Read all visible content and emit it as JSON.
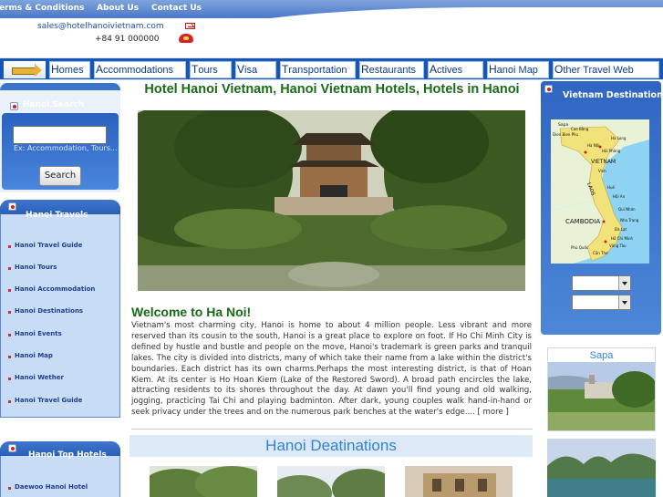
{
  "header": {
    "links": [
      "Terms & Conditions",
      "About Us",
      "Contact Us"
    ],
    "email": "sales@hotelhanoivietnam.com",
    "phone": "+84 91 000000"
  },
  "nav": {
    "items": [
      {
        "first": "H",
        "rest": "omes"
      },
      {
        "first": "A",
        "rest": "ccommodations"
      },
      {
        "first": "T",
        "rest": "ours"
      },
      {
        "first": "V",
        "rest": "isa"
      },
      {
        "first": "T",
        "rest": "ransportation"
      },
      {
        "first": "R",
        "rest": "estaurants"
      },
      {
        "first": "A",
        "rest": "ctives"
      },
      {
        "first": "H",
        "rest": "anoi Map"
      },
      {
        "first": "O",
        "rest": "ther Travel Web"
      }
    ]
  },
  "search": {
    "title": "Hanoi Search",
    "hint": "Ex: Accommodation, Tours...",
    "button": "Search"
  },
  "travels": {
    "title": "Hanoi Travels",
    "items": [
      "Hanoi Travel Guide",
      "Hanoi Tours",
      "Hanoi Accommodation",
      "Hanoi Destinations",
      "Hanoi Events",
      "Hanoi Map",
      "Hanoi Wether",
      "Hanoi Travel Guide"
    ]
  },
  "hotels": {
    "title": "Hanoi Top Hotels",
    "items": [
      "Daewoo Hanoi Hotel"
    ]
  },
  "main": {
    "title": "Hotel Hanoi Vietnam, Hanoi Vietnam Hotels, Hotels in Hanoi",
    "welcome": "Welcome to Ha Noi!",
    "intro": "Vietnam's most charming city, Hanoi is home to about 4 million people. Less vibrant and more reserved than its cousin to the south, Hanoi is a great place to explore on foot. If Ho Chi Minh City is defined by hustle and bustle and people on the move, Hanoi's trademark is green parks and tranquil lakes. The city is divided into districts, many of which take their name from a lake within the district's boundaries. Each district has its own charms.Perhaps the most interesting district, is that of Hoan Kiem. At its center is Ho Hoan Kiem (Lake of the Restored Sword). A broad path encircles the lake, attracting residents to its shores throughout the day. At dawn you'll find young and old walking, jogging, practicing Tai Chi and playing badminton. After dark, young couples walk hand-in-hand or seek privacy under the trees and on the numerous park benches at the water's edge.... ",
    "more": "[ more ]",
    "destinations_title": "Hanoi Deatinations"
  },
  "right": {
    "title": "Vietnam Destinations",
    "map_labels": [
      "Sapa",
      "Cao Bằng",
      "Dien Bien Phu",
      "Ha Long",
      "Hà Nội",
      "Hải Phòng",
      "VIETNAM",
      "Vinh",
      "LAOS",
      "Huế",
      "Hội An",
      "Qui Nhơn",
      "CAMBODIA",
      "Nha Trang",
      "Đà Lạt",
      "Phú Quốc",
      "Vũng Tàu",
      "Hồ Chí Minh",
      "Cần Thơ"
    ],
    "sapa_title": "Sapa"
  },
  "colors": {
    "nav_bg": "#1656b2",
    "title_green": "#1a6b1a",
    "dest_blue": "#2f82d6",
    "panel_blue": "#2f66c2"
  }
}
